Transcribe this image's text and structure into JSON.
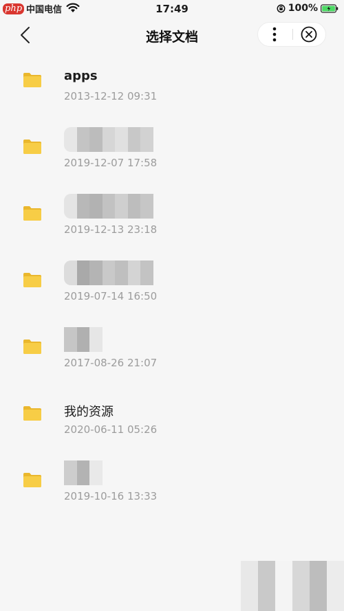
{
  "status_bar": {
    "logo": "php",
    "carrier": "中国电信",
    "time": "17:49",
    "battery": "100%"
  },
  "nav": {
    "title": "选择文档"
  },
  "files": [
    {
      "name": "apps",
      "date": "2013-12-12 09:31",
      "name_blurred": false
    },
    {
      "name": "",
      "date": "2019-12-07 17:58",
      "name_blurred": true
    },
    {
      "name": "",
      "date": "2019-12-13 23:18",
      "name_blurred": true
    },
    {
      "name": "",
      "date": "2019-07-14 16:50",
      "name_blurred": true
    },
    {
      "name": "",
      "date": "2017-08-26 21:07",
      "name_blurred": true
    },
    {
      "name": "我的资源",
      "date": "2020-06-11 05:26",
      "name_blurred": false
    },
    {
      "name": "",
      "date": "2019-10-16 13:33",
      "name_blurred": true
    }
  ],
  "colors": {
    "folder": "#f7cd46",
    "folder_tab": "#eab72d",
    "date_text": "#9c9c9c",
    "background": "#f6f6f6",
    "battery_fill": "#4cd964"
  }
}
